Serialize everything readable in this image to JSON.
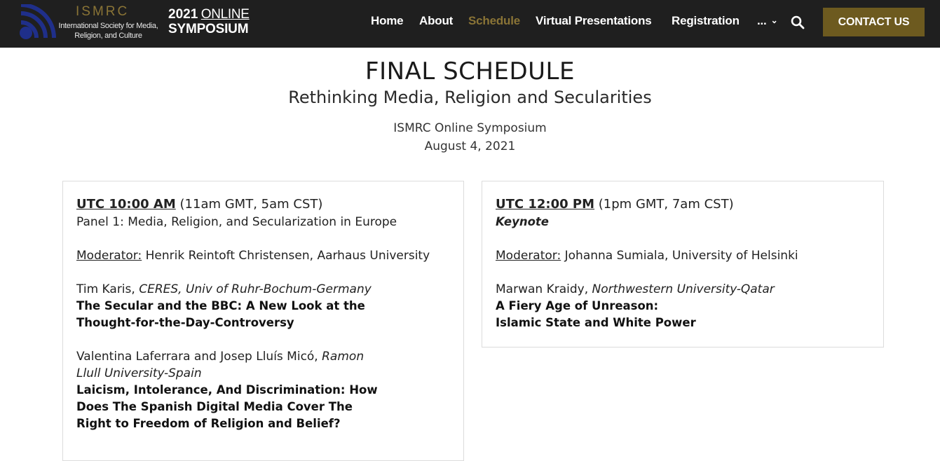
{
  "header": {
    "logo_word": "ISMRC",
    "logo_sub": "International Society for Media, Religion, and Culture",
    "symposium_year": "2021",
    "symposium_online": "ONLINE",
    "symposium_word": "SYMPOSIUM",
    "nav": [
      {
        "label": "Home",
        "active": false
      },
      {
        "label": "About",
        "active": false
      },
      {
        "label": "Schedule",
        "active": true
      },
      {
        "label": "Virtual Presentations",
        "active": false
      },
      {
        "label": "Registration",
        "active": false
      },
      {
        "label": "...",
        "active": false
      }
    ],
    "contact_label": "CONTACT US",
    "colors": {
      "bar": "#1f1f1f",
      "accent": "#8a7436",
      "button": "#6d5a1f"
    }
  },
  "page": {
    "title": "FINAL SCHEDULE",
    "subtitle": "Rethinking Media, Religion and Secularities",
    "event_name": "ISMRC Online Symposium",
    "event_date": "August 4, 2021"
  },
  "sessions": [
    {
      "utc_time": "UTC 10:00 AM",
      "local_times": "(11am GMT, 5am CST)",
      "heading": "Panel 1: Media, Religion, and Secularization in Europe",
      "moderator_label": "Moderator:",
      "moderator": "Henrik Reintoft Christensen, Aarhaus University",
      "presentations": [
        {
          "presenter": "Tim Karis,",
          "affiliation": "CERES, Univ of Ruhr-Bochum-Germany",
          "title_line1": "The Secular and the BBC: A New Look at the",
          "title_line2": "Thought-for-the-Day-Controversy"
        },
        {
          "presenter": "Valentina Laferrara and Josep Lluís Micó,",
          "affiliation_line1": "Ramon",
          "affiliation_line2": "Llull University-Spain",
          "title_line1": "Laicism, Intolerance, And Discrimination: How",
          "title_line2": "Does The Spanish Digital Media Cover The",
          "title_line3": "Right to Freedom of Religion and Belief?"
        }
      ]
    },
    {
      "utc_time": "UTC 12:00 PM",
      "local_times": "(1pm GMT, 7am CST)",
      "heading": "Keynote",
      "moderator_label": "Moderator:",
      "moderator": "Johanna Sumiala, University of Helsinki",
      "presentations": [
        {
          "presenter": "Marwan Kraidy,",
          "affiliation": "Northwestern University-Qatar",
          "title_line1": "A Fiery Age of Unreason:",
          "title_line2": "Islamic State and White Power"
        }
      ]
    }
  ]
}
